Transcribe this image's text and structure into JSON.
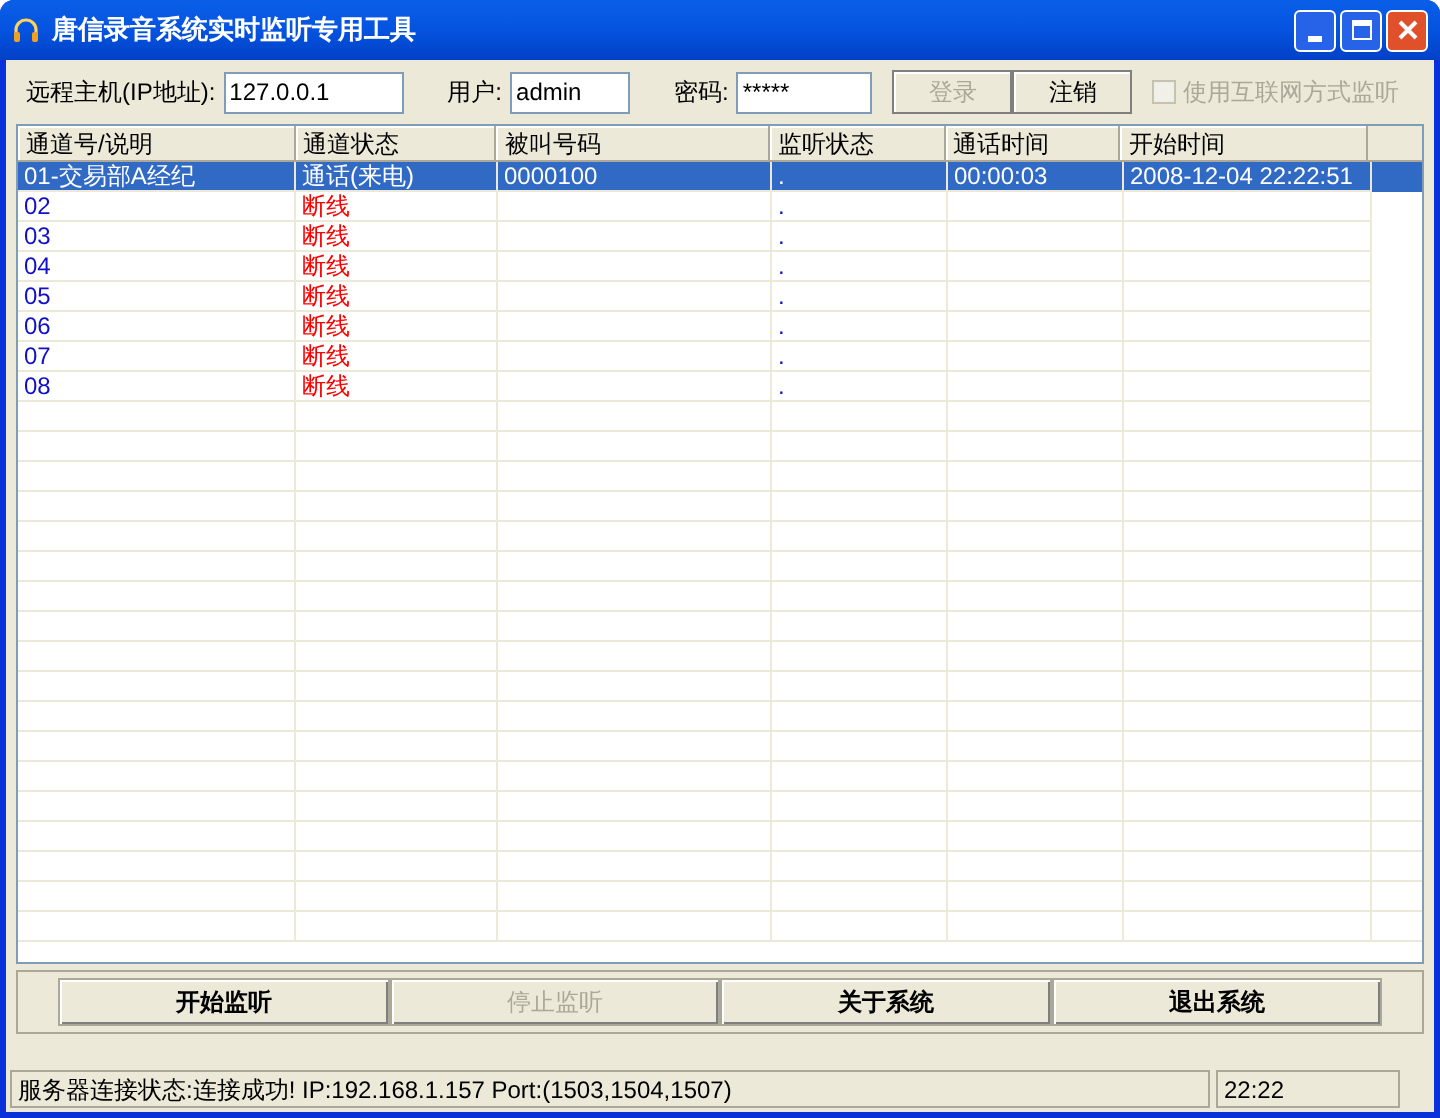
{
  "window": {
    "title": "唐信录音系统实时监听专用工具"
  },
  "connection": {
    "host_label": "远程主机(IP地址):",
    "host": "127.0.0.1",
    "user_label": "用户:",
    "user": "admin",
    "password_label": "密码:",
    "password": "*****",
    "login_button": {
      "label": "登录",
      "disabled": true
    },
    "logout_button": {
      "label": "注销",
      "disabled": false
    },
    "internet_option": {
      "label": "使用互联网方式监听",
      "checked": false,
      "disabled": true
    }
  },
  "table": {
    "columns": [
      "通道号/说明",
      "通道状态",
      "被叫号码",
      "监听状态",
      "通话时间",
      "开始时间"
    ],
    "rows": [
      {
        "selected": true,
        "channel": "01-交易部A经纪",
        "status": "通话(来电)",
        "called": "0000100",
        "monitor": ".",
        "duration": "00:00:03",
        "start": "2008-12-04 22:22:51"
      },
      {
        "selected": false,
        "channel": "02",
        "status": "断线",
        "color": "#ff0000",
        "monitor": "."
      },
      {
        "selected": false,
        "channel": "03",
        "status": "断线",
        "color": "#ff0000",
        "monitor": "."
      },
      {
        "selected": false,
        "channel": "04",
        "status": "断线",
        "color": "#ff0000",
        "monitor": "."
      },
      {
        "selected": false,
        "channel": "05",
        "status": "断线",
        "color": "#ff0000",
        "monitor": "."
      },
      {
        "selected": false,
        "channel": "06",
        "status": "断线",
        "color": "#ff0000",
        "monitor": "."
      },
      {
        "selected": false,
        "channel": "07",
        "status": "断线",
        "color": "#ff0000",
        "monitor": "."
      },
      {
        "selected": false,
        "channel": "08",
        "status": "断线",
        "color": "#ff0000",
        "monitor": "."
      }
    ]
  },
  "buttons": [
    {
      "label": "开始监听",
      "disabled": false
    },
    {
      "label": "停止监听",
      "disabled": true
    },
    {
      "label": "关于系统",
      "disabled": false
    },
    {
      "label": "退出系统",
      "disabled": false
    }
  ],
  "status_bar": {
    "message": "服务器连接状态:连接成功!  IP:192.168.1.157  Port:(1503,1504,1507)",
    "time": "22:22"
  }
}
